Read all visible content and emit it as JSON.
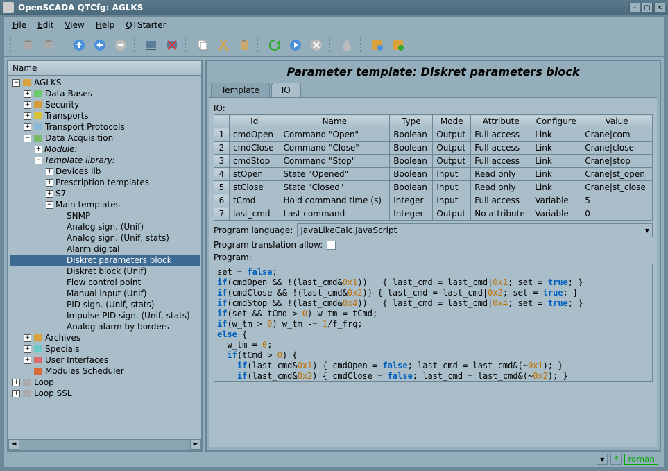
{
  "window_title": "OpenSCADA QTCfg: AGLKS",
  "menu": [
    "File",
    "Edit",
    "View",
    "Help",
    "QTStarter"
  ],
  "left_header": "Name",
  "tree": [
    {
      "d": 0,
      "t": "-",
      "i": "folder",
      "l": "AGLKS"
    },
    {
      "d": 1,
      "t": "+",
      "i": "db",
      "l": "Data Bases"
    },
    {
      "d": 1,
      "t": "+",
      "i": "sec",
      "l": "Security"
    },
    {
      "d": 1,
      "t": "+",
      "i": "tr",
      "l": "Transports"
    },
    {
      "d": 1,
      "t": "+",
      "i": "tp",
      "l": "Transport Protocols"
    },
    {
      "d": 1,
      "t": "-",
      "i": "daq",
      "l": "Data Acquisition"
    },
    {
      "d": 2,
      "t": "+",
      "i": "",
      "l": "Module:",
      "it": true
    },
    {
      "d": 2,
      "t": "-",
      "i": "",
      "l": "Template library:",
      "it": true
    },
    {
      "d": 3,
      "t": "+",
      "i": "",
      "l": "Devices lib"
    },
    {
      "d": 3,
      "t": "+",
      "i": "",
      "l": "Prescription templates"
    },
    {
      "d": 3,
      "t": "+",
      "i": "",
      "l": "S7"
    },
    {
      "d": 3,
      "t": "-",
      "i": "",
      "l": "Main templates"
    },
    {
      "d": 4,
      "t": "",
      "i": "",
      "l": "SNMP"
    },
    {
      "d": 4,
      "t": "",
      "i": "",
      "l": "Analog sign. (Unif)"
    },
    {
      "d": 4,
      "t": "",
      "i": "",
      "l": "Analog sign. (Unif, stats)"
    },
    {
      "d": 4,
      "t": "",
      "i": "",
      "l": "Alarm digital"
    },
    {
      "d": 4,
      "t": "",
      "i": "",
      "l": "Diskret parameters block",
      "sel": true
    },
    {
      "d": 4,
      "t": "",
      "i": "",
      "l": "Diskret block (Unif)"
    },
    {
      "d": 4,
      "t": "",
      "i": "",
      "l": "Flow control point"
    },
    {
      "d": 4,
      "t": "",
      "i": "",
      "l": "Manual input (Unif)"
    },
    {
      "d": 4,
      "t": "",
      "i": "",
      "l": "PID sign. (Unif, stats)"
    },
    {
      "d": 4,
      "t": "",
      "i": "",
      "l": "Impulse PID sign. (Unif, stats)"
    },
    {
      "d": 4,
      "t": "",
      "i": "",
      "l": "Analog alarm by borders"
    },
    {
      "d": 1,
      "t": "+",
      "i": "arc",
      "l": "Archives"
    },
    {
      "d": 1,
      "t": "+",
      "i": "sp",
      "l": "Specials"
    },
    {
      "d": 1,
      "t": "+",
      "i": "ui",
      "l": "User Interfaces"
    },
    {
      "d": 1,
      "t": "",
      "i": "ms",
      "l": "Modules Scheduler"
    },
    {
      "d": 0,
      "t": "+",
      "i": "loop",
      "l": "Loop"
    },
    {
      "d": 0,
      "t": "+",
      "i": "loop",
      "l": "Loop SSL"
    }
  ],
  "page_title": "Parameter template: Diskret parameters block",
  "tabs": [
    "Template",
    "IO"
  ],
  "active_tab": 1,
  "io_label": "IO:",
  "io_cols": [
    "Id",
    "Name",
    "Type",
    "Mode",
    "Attribute",
    "Configure",
    "Value"
  ],
  "io_rows": [
    [
      "cmdOpen",
      "Command \"Open\"",
      "Boolean",
      "Output",
      "Full access",
      "Link",
      "Crane|com"
    ],
    [
      "cmdClose",
      "Command \"Close\"",
      "Boolean",
      "Output",
      "Full access",
      "Link",
      "Crane|close"
    ],
    [
      "cmdStop",
      "Command \"Stop\"",
      "Boolean",
      "Output",
      "Full access",
      "Link",
      "Crane|stop"
    ],
    [
      "stOpen",
      "State \"Opened\"",
      "Boolean",
      "Input",
      "Read only",
      "Link",
      "Crane|st_open"
    ],
    [
      "stClose",
      "State \"Closed\"",
      "Boolean",
      "Input",
      "Read only",
      "Link",
      "Crane|st_close"
    ],
    [
      "tCmd",
      "Hold command time (s)",
      "Integer",
      "Input",
      "Full access",
      "Variable",
      "5"
    ],
    [
      "last_cmd",
      "Last command",
      "Integer",
      "Output",
      "No attribute",
      "Variable",
      "0"
    ]
  ],
  "prog_lang_label": "Program language:",
  "prog_lang_value": "JavaLikeCalc.JavaScript",
  "prog_trans_label": "Program translation allow:",
  "prog_label": "Program:",
  "statusbar_user": "roman"
}
